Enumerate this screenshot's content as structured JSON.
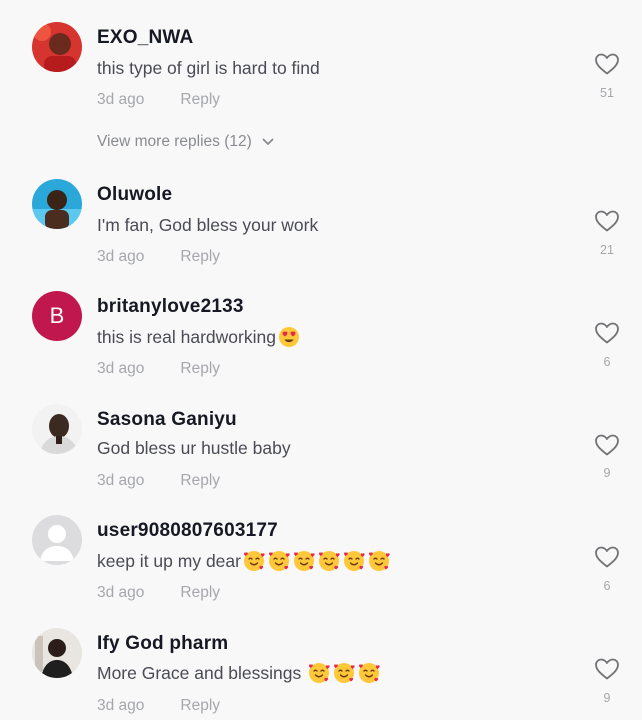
{
  "view_more_label": "View more replies (12)",
  "comments": [
    {
      "username": "EXO_NWA",
      "text": "this type of girl is hard to find",
      "emoji_count": 0,
      "time": "3d ago",
      "reply": "Reply",
      "likes": "51"
    },
    {
      "username": "Oluwole",
      "text": "I'm fan, God bless your work",
      "emoji_count": 0,
      "time": "3d ago",
      "reply": "Reply",
      "likes": "21"
    },
    {
      "username": "britanylove2133",
      "avatar_letter": "B",
      "avatar_color": "#c0174f",
      "text": "this is real hardworking",
      "emoji_count": 1,
      "emoji": "heart-eyes",
      "time": "3d ago",
      "reply": "Reply",
      "likes": "6"
    },
    {
      "username": "Sasona Ganiyu",
      "text": "God bless ur hustle baby",
      "emoji_count": 0,
      "time": "3d ago",
      "reply": "Reply",
      "likes": "9"
    },
    {
      "username": "user9080807603177",
      "text": "keep it up my dear",
      "emoji_count": 6,
      "emoji": "smiling-face-with-hearts",
      "time": "3d ago",
      "reply": "Reply",
      "likes": "6"
    },
    {
      "username": "Ify God pharm",
      "text": "More Grace and blessings ",
      "emoji_count": 3,
      "emoji": "smiling-face-with-hearts",
      "time": "3d ago",
      "reply": "Reply",
      "likes": "9"
    }
  ]
}
